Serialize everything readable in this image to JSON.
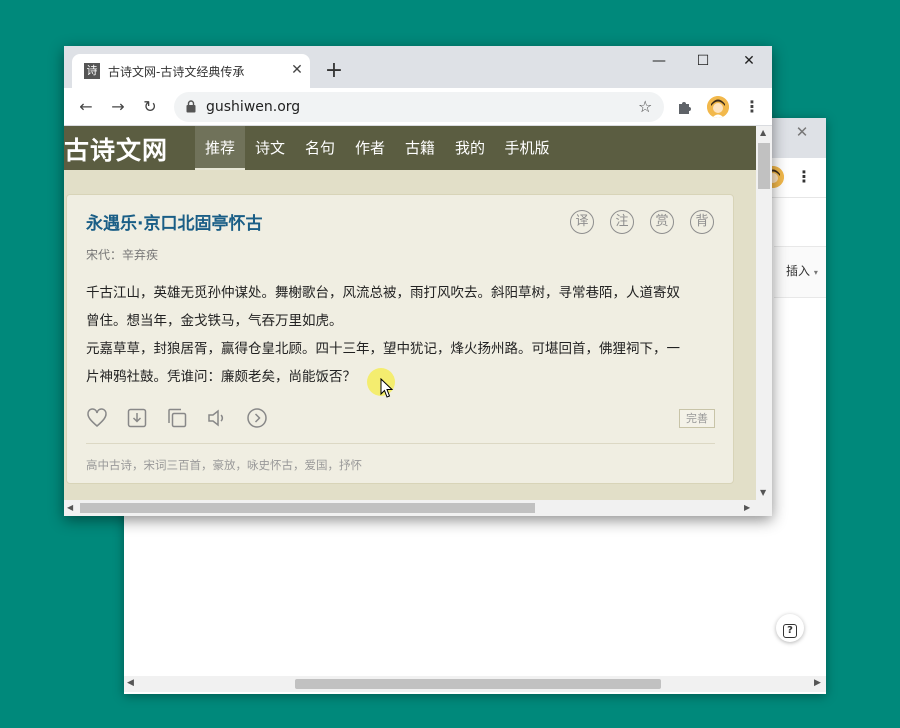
{
  "background_window": {
    "close_glyph": "✕",
    "menu_glyph": "⋮",
    "insert_label": "插入",
    "help_glyph": "?"
  },
  "browser": {
    "tab": {
      "favicon_text": "诗",
      "title": "古诗文网-古诗文经典传承",
      "close_glyph": "✕"
    },
    "new_tab_glyph": "+",
    "window_controls": {
      "minimize": "—",
      "maximize": "☐",
      "close": "✕"
    },
    "nav": {
      "back": "←",
      "forward": "→",
      "reload": "↻"
    },
    "url": "gushiwen.org",
    "star_glyph": "☆",
    "menu_glyph": "⋮"
  },
  "site": {
    "logo": "古诗文网",
    "nav": [
      {
        "label": "推荐",
        "active": true
      },
      {
        "label": "诗文",
        "active": false
      },
      {
        "label": "名句",
        "active": false
      },
      {
        "label": "作者",
        "active": false
      },
      {
        "label": "古籍",
        "active": false
      },
      {
        "label": "我的",
        "active": false
      },
      {
        "label": "手机版",
        "active": false
      }
    ]
  },
  "poem": {
    "title": "永遇乐·京口北固亭怀古",
    "meta": "宋代：辛弃疾",
    "circle_buttons": [
      "译",
      "注",
      "赏",
      "背"
    ],
    "lines": [
      "千古江山，英雄无觅孙仲谋处。舞榭歌台，风流总被，雨打风吹去。斜阳草树，寻常巷陌，人道寄奴",
      "曾住。想当年，金戈铁马，气吞万里如虎。",
      "元嘉草草，封狼居胥，赢得仓皇北顾。四十三年，望中犹记，烽火扬州路。可堪回首，佛狸祠下，一",
      "片神鸦社鼓。凭谁问：廉颇老矣，尚能饭否？"
    ],
    "complete_label": "完善",
    "tags": "高中古诗，宋词三百首，豪放，咏史怀古，爱国，抒怀"
  },
  "colors": {
    "desktop": "#00897b",
    "site_header": "#5b5d41",
    "page_bg": "#e2dfc8",
    "title_blue": "#1a5e86"
  }
}
